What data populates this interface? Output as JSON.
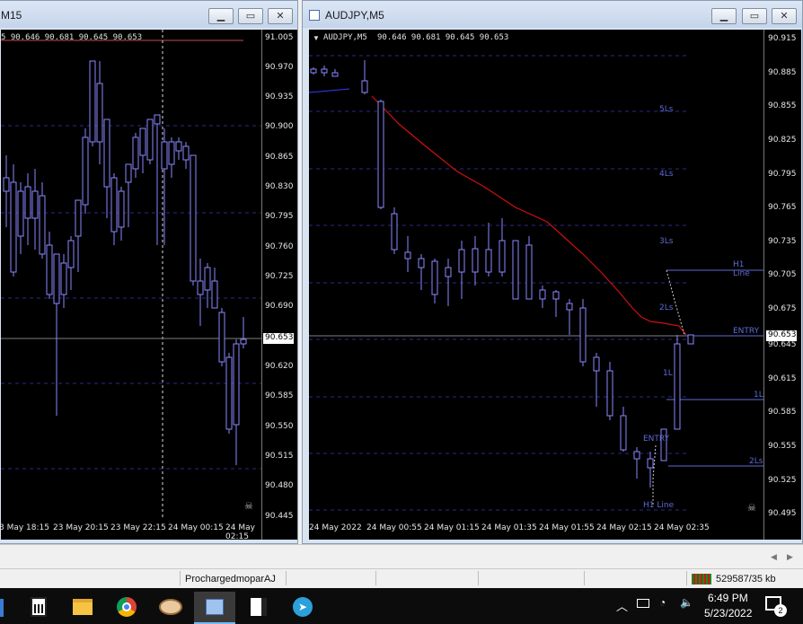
{
  "windows": {
    "left": {
      "title": "M15",
      "header": "5  90.646 90.681 90.645 90.653",
      "price_badge": "90.653",
      "y_labels": [
        "91.005",
        "90.970",
        "90.935",
        "90.900",
        "90.865",
        "90.830",
        "90.795",
        "90.760",
        "90.725",
        "90.690",
        "90.620",
        "90.585",
        "90.550",
        "90.515",
        "90.480",
        "90.445"
      ],
      "x_labels": [
        "3 May 18:15",
        "23 May 20:15",
        "23 May 22:15",
        "24 May 00:15",
        "24 May 02:15"
      ]
    },
    "right": {
      "title": "AUDJPY,M5",
      "header_symbol": "AUDJPY,M5",
      "header_quotes": "90.646 90.681 90.645 90.653",
      "price_badge": "90.653",
      "y_labels": [
        "90.915",
        "90.885",
        "90.855",
        "90.825",
        "90.795",
        "90.765",
        "90.735",
        "90.705",
        "90.675",
        "90.645",
        "90.615",
        "90.585",
        "90.555",
        "90.525",
        "90.495"
      ],
      "x_labels": [
        "24 May 2022",
        "24 May 00:55",
        "24 May 01:15",
        "24 May 01:35",
        "24 May 01:55",
        "24 May 02:15",
        "24 May 02:35"
      ],
      "levels": {
        "l5s": "5Ls",
        "l4s": "4Ls",
        "l3s": "3Ls",
        "l2s": "2Ls",
        "l1": "1L",
        "h1line": "H1 Line",
        "entry": "ENTRY",
        "r1l": "1L",
        "r2ls": "2Ls",
        "entry_low": "ENTRY",
        "h1line_low": "H1 Line"
      }
    }
  },
  "statusbar": {
    "profile": "ProchargedmoparAJ",
    "traffic": "529587/35 kb"
  },
  "taskbar": {
    "time": "6:49 PM",
    "date": "5/23/2022",
    "notification_count": "2",
    "icons": [
      "calculator-icon",
      "file-explorer-icon",
      "chrome-icon",
      "paint-icon",
      "metatrader-icon",
      "sticky-notes-icon",
      "telegram-icon"
    ]
  }
}
